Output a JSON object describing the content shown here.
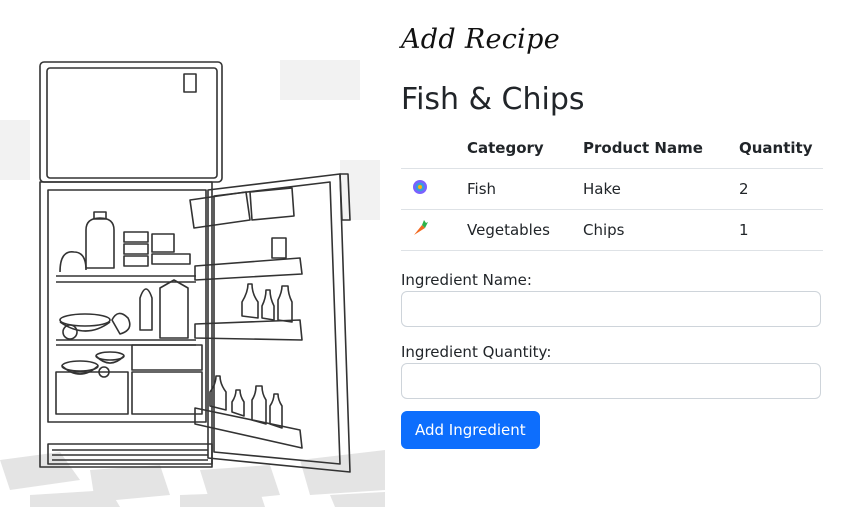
{
  "header": {
    "brand": "Add Recipe"
  },
  "recipe": {
    "title": "Fish & Chips"
  },
  "table": {
    "headers": [
      "",
      "Category",
      "Product Name",
      "Quantity"
    ],
    "rows": [
      {
        "icon": "fish-icon",
        "category": "Fish",
        "product": "Hake",
        "quantity": "2"
      },
      {
        "icon": "carrot-icon",
        "category": "Vegetables",
        "product": "Chips",
        "quantity": "1"
      }
    ]
  },
  "form": {
    "name_label": "Ingredient Name:",
    "name_value": "",
    "quantity_label": "Ingredient Quantity:",
    "quantity_value": "",
    "submit_label": "Add Ingredient"
  },
  "colors": {
    "primary": "#0d6efd",
    "carrot": "#f36a21",
    "fish": "#3a7bd5"
  }
}
